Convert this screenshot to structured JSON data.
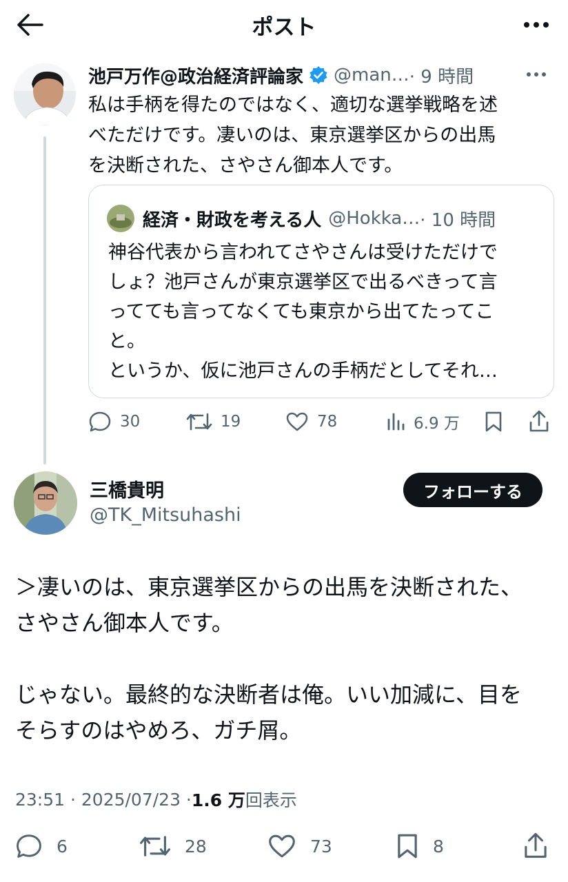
{
  "header": {
    "title": "ポスト",
    "back_icon": "arrow-left-icon",
    "more_icon": "more-horizontal-icon"
  },
  "parent_post": {
    "author_name": "池戸万作@政治経済評論家",
    "verified": true,
    "handle": "@man…",
    "time": "· 9 時間",
    "text": "私は手柄を得たのではなく、適切な選挙戦略を述\nべただけです。凄いのは、東京選挙区からの出馬\nを決断された、さやさん御本人です。",
    "quote": {
      "author_name": "経済・財政を考える人",
      "handle": "@Hokka…",
      "time": "· 10 時間",
      "text": "神谷代表から言われてさやさんは受けただけで\nしょ？池戸さんが東京選挙区で出るべきって言\nってても言ってなくても東京から出てたってこ\nと。\nというか、仮に池戸さんの手柄だとしてそれ…"
    },
    "actions": {
      "replies": "30",
      "reposts": "19",
      "likes": "78",
      "views": "6.9 万"
    }
  },
  "main_post": {
    "author_name": "三橋貴明",
    "handle": "@TK_Mitsuhashi",
    "follow_label": "フォローする",
    "text": "＞凄いのは、東京選挙区からの出馬を決断された、\nさやさん御本人です。\n\nじゃない。最終的な決断者は俺。いい加減に、目を\nそらすのはやめろ、ガチ屑。",
    "timestamp": "23:51 · 2025/07/23 · ",
    "views_count": "1.6 万",
    "views_label": "回表示",
    "actions": {
      "replies": "6",
      "reposts": "28",
      "likes": "73",
      "bookmarks": "8"
    }
  },
  "colors": {
    "text": "#0f1419",
    "secondary": "#536471",
    "border": "#cfd9de",
    "verified": "#1d9bf0"
  }
}
